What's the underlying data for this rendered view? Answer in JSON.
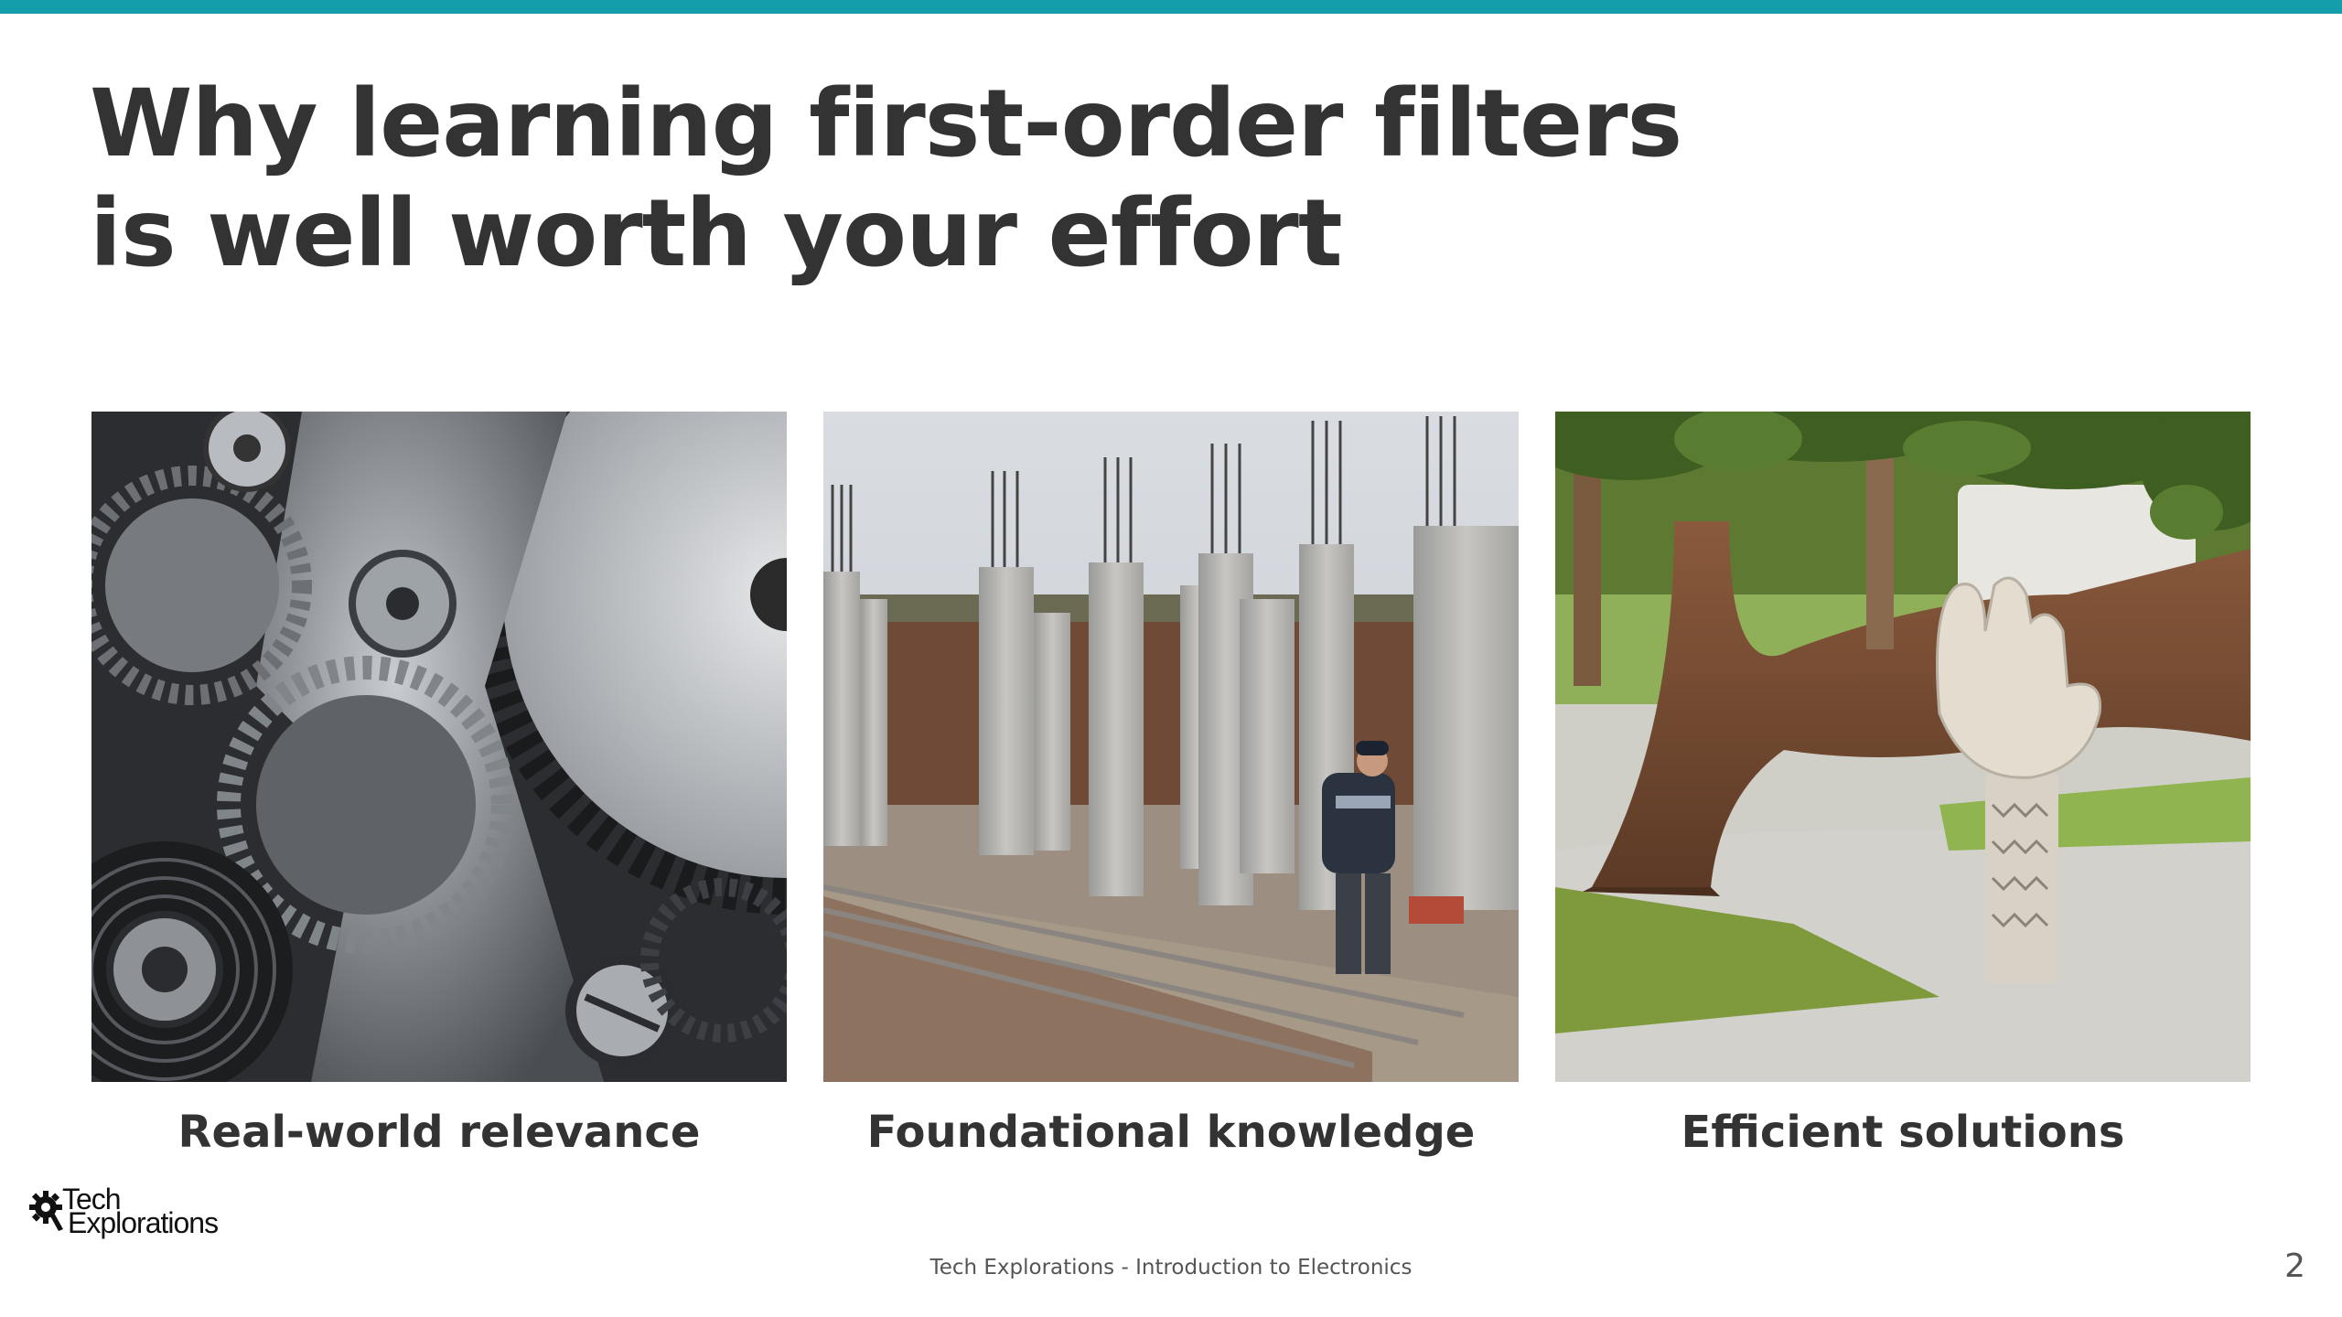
{
  "slide": {
    "accent_color": "#149eab",
    "title_line1": "Why learning first-order filters",
    "title_line2": "is well worth your effort",
    "cards": [
      {
        "caption": "Real-world relevance",
        "image": "metal-gears-photo"
      },
      {
        "caption": "Foundational knowledge",
        "image": "concrete-pillars-construction-photo"
      },
      {
        "caption": "Efficient solutions",
        "image": "carved-hand-supporting-tree-photo"
      }
    ],
    "logo": {
      "line1": "Tech",
      "line2": "Explorations",
      "icon": "gear-icon"
    },
    "footer": "Tech Explorations - Introduction to Electronics",
    "page_number": "2"
  }
}
